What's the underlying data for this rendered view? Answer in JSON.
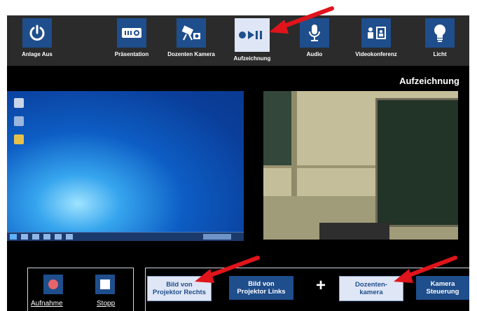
{
  "toolbar": {
    "items": [
      {
        "label": "Anlage Aus",
        "icon": "power-icon"
      },
      {
        "label": "Präsentation",
        "icon": "projector-icon"
      },
      {
        "label": "Dozenten Kamera",
        "icon": "camera-icon"
      },
      {
        "label": "Aufzeichnung",
        "icon": "record-play-pause-icon"
      },
      {
        "label": "Audio",
        "icon": "microphone-icon"
      },
      {
        "label": "Videokonferenz",
        "icon": "videoconference-icon"
      },
      {
        "label": "Licht",
        "icon": "lightbulb-icon"
      }
    ],
    "active": "Aufzeichnung"
  },
  "section_title": "Aufzeichnung",
  "recording": {
    "record_label": "Aufnahme",
    "stop_label": "Stopp"
  },
  "sources": {
    "projector_right": "Bild von\nProjektor Rechts",
    "projector_left": "Bild von\nProjektor Links",
    "plus": "+",
    "lecturer_camera": "Dozenten-\nkamera",
    "camera_control": "Kamera\nSteuerung"
  },
  "colors": {
    "accent_blue": "#1f4e8c",
    "light_button": "#dfe6f5",
    "record_dot": "#e8656b",
    "annotation_arrow": "#e0141b"
  }
}
